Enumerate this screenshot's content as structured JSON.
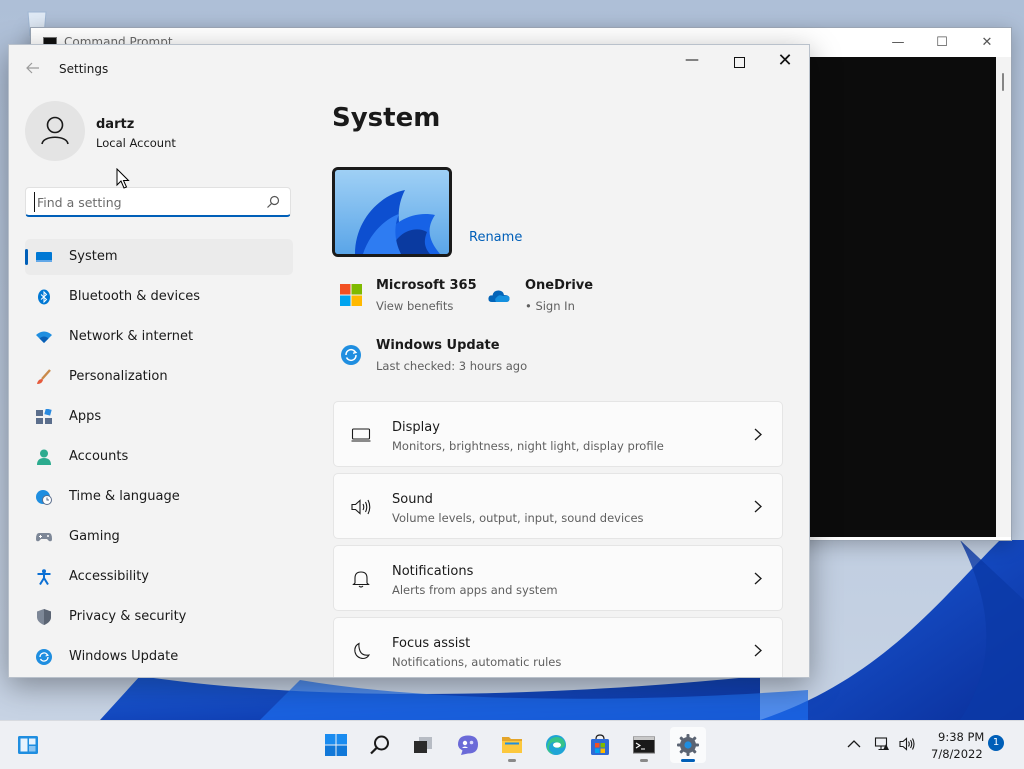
{
  "colors": {
    "accent": "#005fb8",
    "window_bg": "#f3f3f3",
    "card_bg": "#fbfbfb",
    "console_bg": "#0c0c0c"
  },
  "cmd_window": {
    "title": "Command Prompt",
    "controls": {
      "minimize": "—",
      "maximize": "☐",
      "close": "✕"
    }
  },
  "settings": {
    "app_title": "Settings",
    "back_icon": "back-arrow-icon",
    "window_controls": {
      "minimize": "—",
      "close": "✕"
    },
    "user": {
      "name": "dartz",
      "account_type": "Local Account"
    },
    "search": {
      "placeholder": "Find a setting",
      "value": ""
    },
    "nav": [
      {
        "label": "System",
        "icon": "monitor-icon",
        "selected": true
      },
      {
        "label": "Bluetooth & devices",
        "icon": "bluetooth-icon"
      },
      {
        "label": "Network & internet",
        "icon": "wifi-icon"
      },
      {
        "label": "Personalization",
        "icon": "brush-icon"
      },
      {
        "label": "Apps",
        "icon": "apps-icon"
      },
      {
        "label": "Accounts",
        "icon": "person-icon"
      },
      {
        "label": "Time & language",
        "icon": "globe-clock-icon"
      },
      {
        "label": "Gaming",
        "icon": "controller-icon"
      },
      {
        "label": "Accessibility",
        "icon": "accessibility-icon"
      },
      {
        "label": "Privacy & security",
        "icon": "shield-icon"
      },
      {
        "label": "Windows Update",
        "icon": "update-icon"
      }
    ],
    "page": {
      "title": "System",
      "rename_label": "Rename",
      "tiles": [
        {
          "title": "Microsoft 365",
          "subtitle": "View benefits",
          "icon": "microsoft-logo-icon"
        },
        {
          "title": "OneDrive",
          "subtitle": "• Sign In",
          "icon": "cloud-icon"
        },
        {
          "title": "Windows Update",
          "subtitle": "Last checked: 3 hours ago",
          "icon": "update-icon"
        }
      ],
      "cards": [
        {
          "title": "Display",
          "subtitle": "Monitors, brightness, night light, display profile",
          "icon": "display-icon"
        },
        {
          "title": "Sound",
          "subtitle": "Volume levels, output, input, sound devices",
          "icon": "speaker-icon"
        },
        {
          "title": "Notifications",
          "subtitle": "Alerts from apps and system",
          "icon": "bell-icon"
        },
        {
          "title": "Focus assist",
          "subtitle": "Notifications, automatic rules",
          "icon": "moon-icon"
        }
      ]
    }
  },
  "taskbar": {
    "apps": [
      {
        "name": "start",
        "icon": "windows-logo-icon"
      },
      {
        "name": "search",
        "icon": "search-icon"
      },
      {
        "name": "task-view",
        "icon": "task-view-icon"
      },
      {
        "name": "chat",
        "icon": "chat-icon"
      },
      {
        "name": "file-explorer",
        "icon": "folder-icon"
      },
      {
        "name": "edge",
        "icon": "edge-icon"
      },
      {
        "name": "store",
        "icon": "store-icon"
      },
      {
        "name": "terminal",
        "icon": "terminal-icon"
      },
      {
        "name": "settings",
        "icon": "gear-icon",
        "active": true
      }
    ],
    "clock": {
      "time": "9:38 PM",
      "date": "7/8/2022"
    },
    "notification_count": "1"
  }
}
